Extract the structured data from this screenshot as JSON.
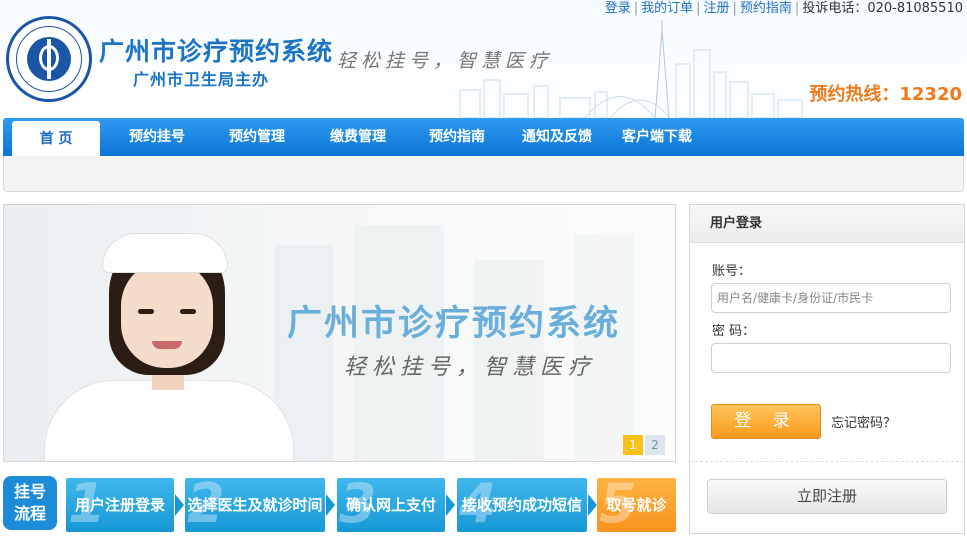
{
  "top_links": {
    "login": "登录",
    "my_orders": "我的订单",
    "register": "注册",
    "guide": "预约指南",
    "complaint": "投诉电话：020-81085510"
  },
  "header": {
    "title": "广州市诊疗预约系统",
    "subtitle": "广州市卫生局主办",
    "slogan": "轻松挂号，智慧医疗",
    "hotline": "预约热线：12320",
    "logo_icon": "health-bureau-emblem-icon"
  },
  "nav": {
    "items": [
      "首 页",
      "预约挂号",
      "预约管理",
      "缴费管理",
      "预约指南",
      "通知及反馈",
      "客户端下载"
    ],
    "active_index": 0
  },
  "banner": {
    "title": "广州市诊疗预约系统",
    "slogan": "轻松挂号，智慧医疗",
    "pages": [
      "1",
      "2"
    ],
    "current_page": "1"
  },
  "steps": {
    "label": "挂号流程",
    "items": [
      {
        "num": "1",
        "text": "用户注册登录"
      },
      {
        "num": "2",
        "text": "选择医生及就诊时间"
      },
      {
        "num": "3",
        "text": "确认网上支付"
      },
      {
        "num": "4",
        "text": "接收预约成功短信"
      },
      {
        "num": "5",
        "text": "取号就诊"
      }
    ]
  },
  "login": {
    "heading": "用户登录",
    "account_label": "账号：",
    "account_placeholder": "用户名/健康卡/身份证/市民卡",
    "account_value": "",
    "password_label": "密  码：",
    "password_value": "",
    "submit_label": "登 录",
    "forgot_label": "忘记密码？",
    "register_label": "立即注册"
  },
  "colors": {
    "brand_blue": "#1b74c5",
    "nav_blue": "#0c74d6",
    "accent_orange": "#f7931e",
    "pager_active": "#f7c11a"
  }
}
